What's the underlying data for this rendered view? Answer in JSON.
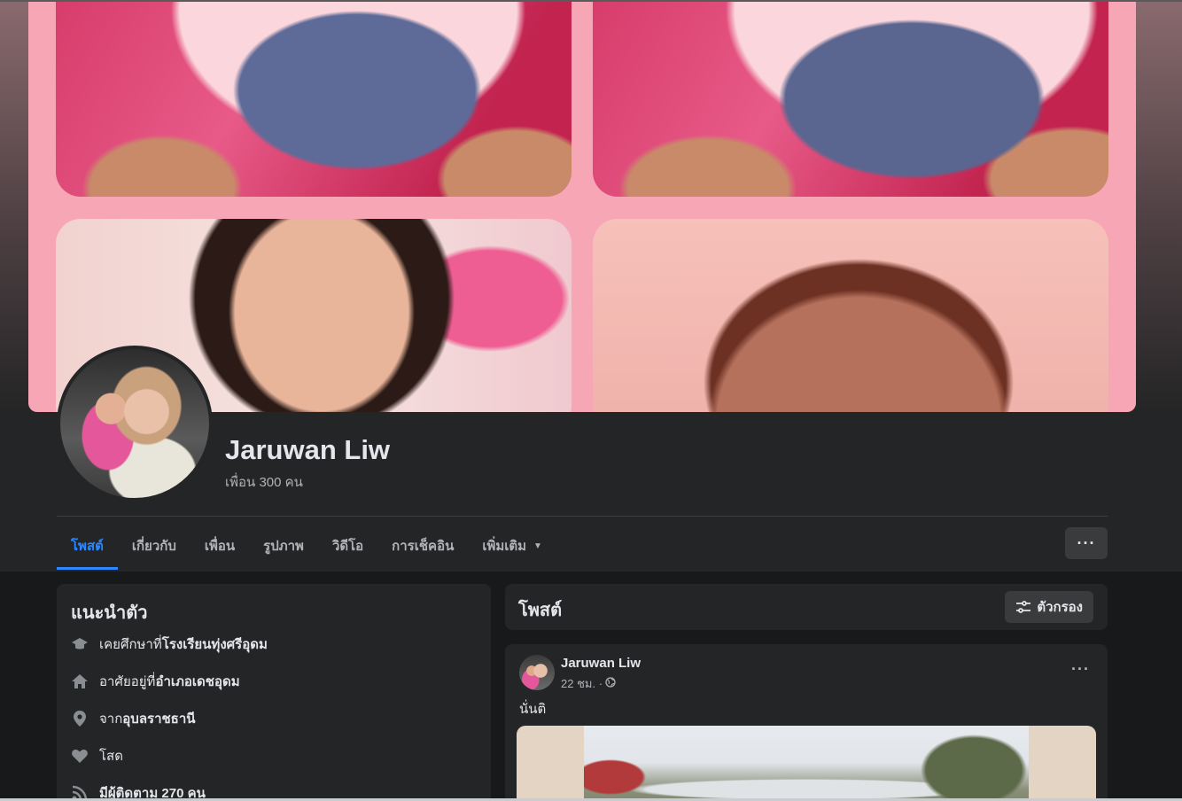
{
  "profile": {
    "name": "Jaruwan Liw",
    "friends": "เพื่อน 300 คน"
  },
  "tabs": [
    {
      "label": "โพสต์",
      "active": true
    },
    {
      "label": "เกี่ยวกับ"
    },
    {
      "label": "เพื่อน"
    },
    {
      "label": "รูปภาพ"
    },
    {
      "label": "วิดีโอ"
    },
    {
      "label": "การเช็คอิน"
    },
    {
      "label": "เพิ่มเติม"
    }
  ],
  "more_menu": "···",
  "intro": {
    "title": "แนะนำตัว",
    "items": [
      {
        "icon": "graduation-cap-icon",
        "prefix": "เคยศึกษาที่ ",
        "value": "โรงเรียนทุ่งศรีอุดม"
      },
      {
        "icon": "home-icon",
        "prefix": "อาศัยอยู่ที่ ",
        "value": "อำเภอเดชอุดม"
      },
      {
        "icon": "location-pin-icon",
        "prefix": "จาก ",
        "value": "อุบลราชธานี"
      },
      {
        "icon": "heart-icon",
        "prefix": "",
        "value": "โสด"
      },
      {
        "icon": "rss-follow-icon",
        "prefix": "",
        "value": "มีผู้ติดตาม 270 คน"
      }
    ]
  },
  "posts_section": {
    "title": "โพสต์",
    "filter_label": "ตัวกรอง"
  },
  "post": {
    "author": "Jaruwan Liw",
    "time": "22 ชม. ·",
    "audience_icon": "globe-icon",
    "menu": "···",
    "text": "นั่นติ"
  },
  "colors": {
    "background": "#18191a",
    "card": "#242526",
    "accent": "#2d88ff",
    "secondary_text": "#b0b3b8",
    "cover_pink": "#f7a6b6"
  }
}
